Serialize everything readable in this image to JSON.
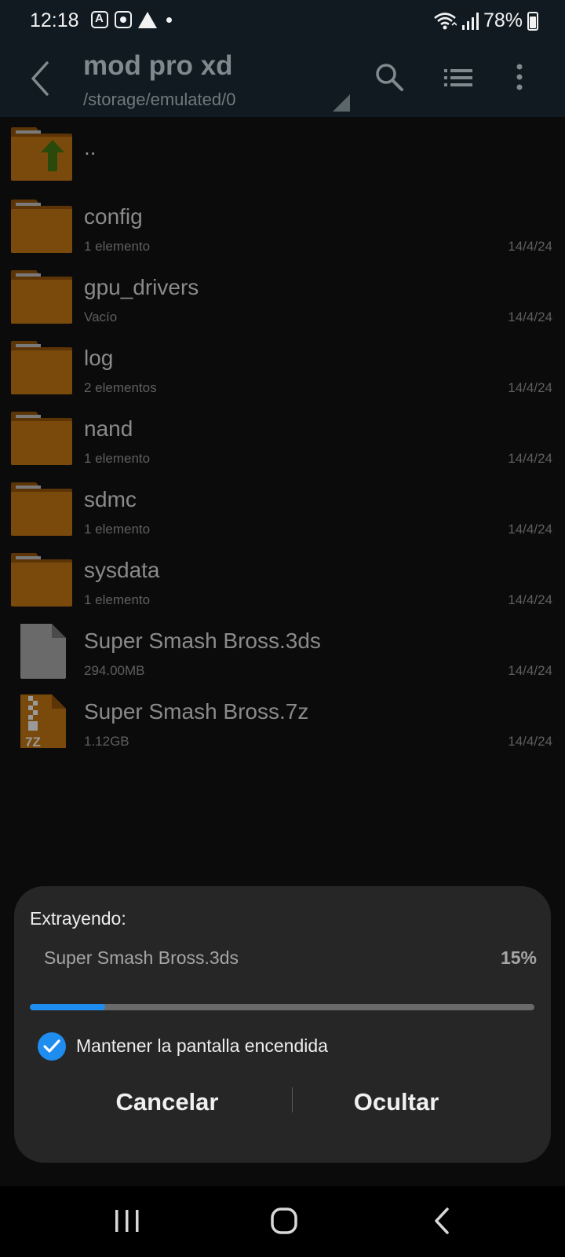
{
  "status_bar": {
    "time": "12:18",
    "left_icons": [
      "translate-notification-icon",
      "screen-record-icon",
      "warning-icon",
      "dot-icon"
    ],
    "right_icons": [
      "wifi-icon",
      "signal-icon"
    ],
    "battery": "78%",
    "battery_level": 0.78
  },
  "toolbar": {
    "title": "mod pro xd",
    "path": "/storage/emulated/0",
    "icons": [
      "back-icon",
      "search-icon",
      "list-view-icon",
      "more-vert-icon"
    ]
  },
  "files": [
    {
      "name": "..",
      "meta": "",
      "date": "",
      "kind": "parent-folder"
    },
    {
      "name": "config",
      "meta": "1 elemento",
      "date": "14/4/24",
      "kind": "folder"
    },
    {
      "name": "gpu_drivers",
      "meta": "Vacío",
      "date": "14/4/24",
      "kind": "folder"
    },
    {
      "name": "log",
      "meta": "2 elementos",
      "date": "14/4/24",
      "kind": "folder"
    },
    {
      "name": "nand",
      "meta": "1 elemento",
      "date": "14/4/24",
      "kind": "folder"
    },
    {
      "name": "sdmc",
      "meta": "1 elemento",
      "date": "14/4/24",
      "kind": "folder"
    },
    {
      "name": "sysdata",
      "meta": "1 elemento",
      "date": "14/4/24",
      "kind": "folder"
    },
    {
      "name": "Super Smash Bross.3ds",
      "meta": "294.00MB",
      "date": "14/4/24",
      "kind": "file"
    },
    {
      "name": "Super Smash Bross.7z",
      "meta": "1.12GB",
      "date": "14/4/24",
      "kind": "archive",
      "badge": "7Z"
    }
  ],
  "dialog": {
    "title": "Extrayendo:",
    "file": "Super Smash Bross.3ds",
    "percent": "15%",
    "progress": 0.15,
    "keep_screen_on_label": "Mantener la pantalla encendida",
    "keep_screen_on_checked": true,
    "cancel_label": "Cancelar",
    "hide_label": "Ocultar"
  },
  "nav_bar": {
    "icons": [
      "recents-icon",
      "home-icon",
      "back-icon"
    ]
  },
  "colors": {
    "accent": "#1f8cf0",
    "folder": "#7a4a0c",
    "folder_tab": "#5c3406",
    "toolbar_bg": "#101a20",
    "dialog_bg": "#262626",
    "background": "#0b0b0b"
  }
}
